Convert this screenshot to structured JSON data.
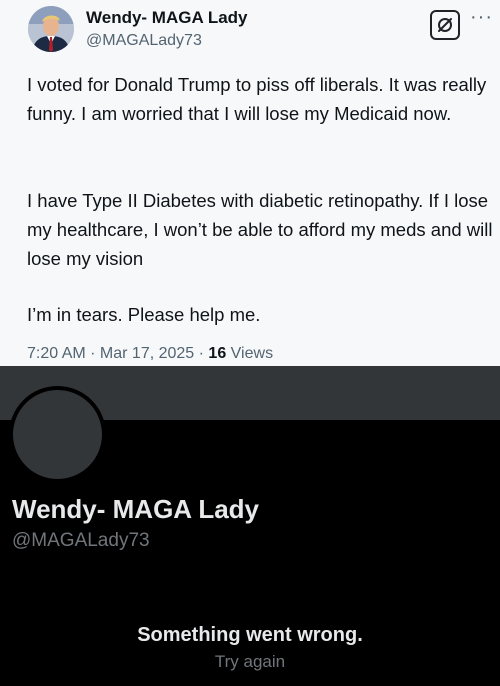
{
  "tweet": {
    "author_name": "Wendy- MAGA Lady",
    "handle": "@MAGALady73",
    "paragraphs": [
      "I voted for Donald Trump to piss off liberals. It was really funny. I am worried that I will lose my Medicaid now.",
      "I have Type II Diabetes with diabetic retinopathy. If I lose my healthcare, I won’t be able to afford my meds and will lose my vision",
      "I’m in tears. Please help me."
    ],
    "time": "7:20 AM",
    "date": "Mar 17, 2025",
    "separator": " · ",
    "views_count": "16",
    "views_label": "Views",
    "more_icon": "more-horizontal-icon",
    "grok_icon": "grok-icon"
  },
  "profile": {
    "name": "Wendy- MAGA Lady",
    "handle": "@MAGALady73",
    "error_message": "Something went wrong.",
    "retry_label": "Try again"
  },
  "colors": {
    "tweet_background": "#f7f8fa",
    "banner": "#333639",
    "profile_background": "#000000",
    "secondary_text": "#536471",
    "dark_secondary_text": "#71767b"
  }
}
